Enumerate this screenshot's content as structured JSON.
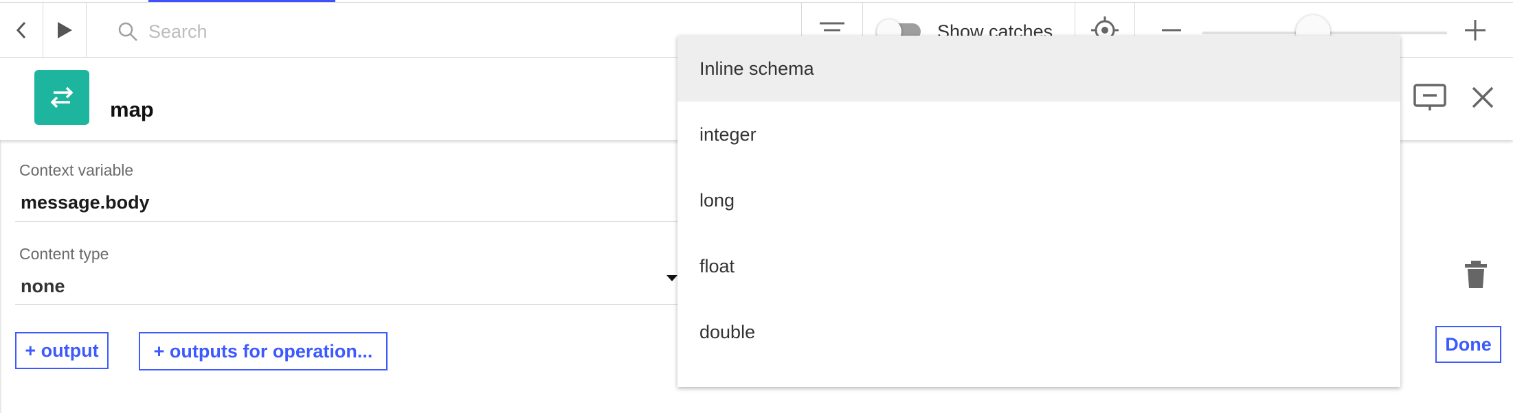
{
  "toolbar": {
    "search_placeholder": "Search",
    "show_catches_label": "Show catches",
    "show_catches_on": false,
    "zoom_level": 0.45
  },
  "node": {
    "title": "map",
    "icon": "swap-arrows-icon",
    "icon_color": "#1eb59e"
  },
  "form": {
    "context_variable_label": "Context variable",
    "context_variable_value": "message.body",
    "content_type_label": "Content type",
    "content_type_value": "none",
    "add_output_label": "+ output",
    "add_outputs_for_operation_label": "+ outputs for operation...",
    "done_label": "Done"
  },
  "dropdown": {
    "options": [
      "Inline schema",
      "integer",
      "long",
      "float",
      "double"
    ],
    "highlighted_index": 0
  },
  "colors": {
    "accent": "#3d5afe",
    "node_teal": "#1eb59e"
  }
}
